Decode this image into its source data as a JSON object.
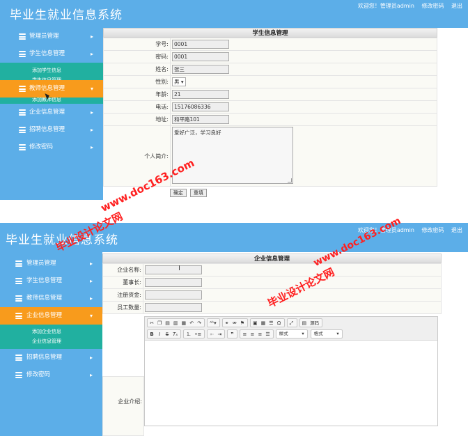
{
  "screen1": {
    "app_title": "毕业生就业信息系统",
    "top_links": {
      "welcome": "欢迎您！管理员admin",
      "change_password": "修改密码",
      "logout": "退出"
    },
    "sidebar": [
      {
        "label": "管理员管理",
        "active": false
      },
      {
        "label": "学生信息管理",
        "active": false
      },
      {
        "label": "教师信息管理",
        "active": true
      },
      {
        "label": "企业信息管理",
        "active": false
      },
      {
        "label": "招聘信息管理",
        "active": false
      },
      {
        "label": "修改密码",
        "active": false
      }
    ],
    "submenu_above": [
      "添加学生信息",
      "学生信息管理"
    ],
    "submenu_below": [
      "添加教师信息"
    ],
    "form_title": "学生信息管理",
    "fields": [
      {
        "label": "学号:",
        "value": "0001"
      },
      {
        "label": "密码:",
        "value": "0001"
      },
      {
        "label": "姓名:",
        "value": "张三"
      },
      {
        "label": "性别:",
        "value": "男"
      },
      {
        "label": "年龄:",
        "value": "21"
      },
      {
        "label": "电话:",
        "value": "15176086336"
      },
      {
        "label": "地址:",
        "value": "和平路101"
      }
    ],
    "intro_label": "个人简介:",
    "intro_value": "爱好广泛，学习良好",
    "buttons": {
      "confirm": "确定",
      "reset": "重填"
    }
  },
  "screen2": {
    "app_title": "毕业生就业信息系统",
    "top_links": {
      "welcome": "欢迎您！管理员admin",
      "change_password": "修改密码",
      "logout": "退出"
    },
    "sidebar": [
      {
        "label": "管理员管理",
        "active": false
      },
      {
        "label": "学生信息管理",
        "active": false
      },
      {
        "label": "教师信息管理",
        "active": false
      },
      {
        "label": "企业信息管理",
        "active": true
      },
      {
        "label": "招聘信息管理",
        "active": false
      },
      {
        "label": "修改密码",
        "active": false
      }
    ],
    "submenu": [
      "添加企业信息",
      "企业信息管理"
    ],
    "form_title": "企业信息管理",
    "fields": [
      {
        "label": "企业名称:",
        "value": ""
      },
      {
        "label": "董事长:",
        "value": ""
      },
      {
        "label": "注册资金:",
        "value": ""
      },
      {
        "label": "员工数量:",
        "value": ""
      }
    ],
    "intro_label": "企业介绍:",
    "editor": {
      "source_label": "源码",
      "style_dropdown": "样式",
      "format_dropdown": "格式",
      "toolbar_row1": [
        "cut-icon",
        "copy-icon",
        "paste-icon",
        "paste-text-icon",
        "paste-word-icon",
        "undo-icon",
        "redo-icon",
        "spellcheck-icon",
        "link-icon",
        "unlink-icon",
        "anchor-icon",
        "image-icon",
        "table-icon",
        "horizontal-rule-icon",
        "special-char-icon",
        "maximize-icon",
        "source-icon"
      ],
      "toolbar_row2": [
        "bold-icon",
        "italic-icon",
        "strike-icon",
        "remove-format-icon",
        "numbered-list-icon",
        "bulleted-list-icon",
        "outdent-icon",
        "indent-icon",
        "blockquote-icon",
        "align-left-icon",
        "align-center-icon",
        "align-right-icon",
        "justify-icon"
      ]
    }
  },
  "watermarks": [
    "www.doc163.com",
    "毕业设计论文网"
  ],
  "colors": {
    "header": "#5caee8",
    "active_nav": "#f89b1c",
    "submenu": "#21b0a0",
    "watermark": "#ff2020"
  }
}
